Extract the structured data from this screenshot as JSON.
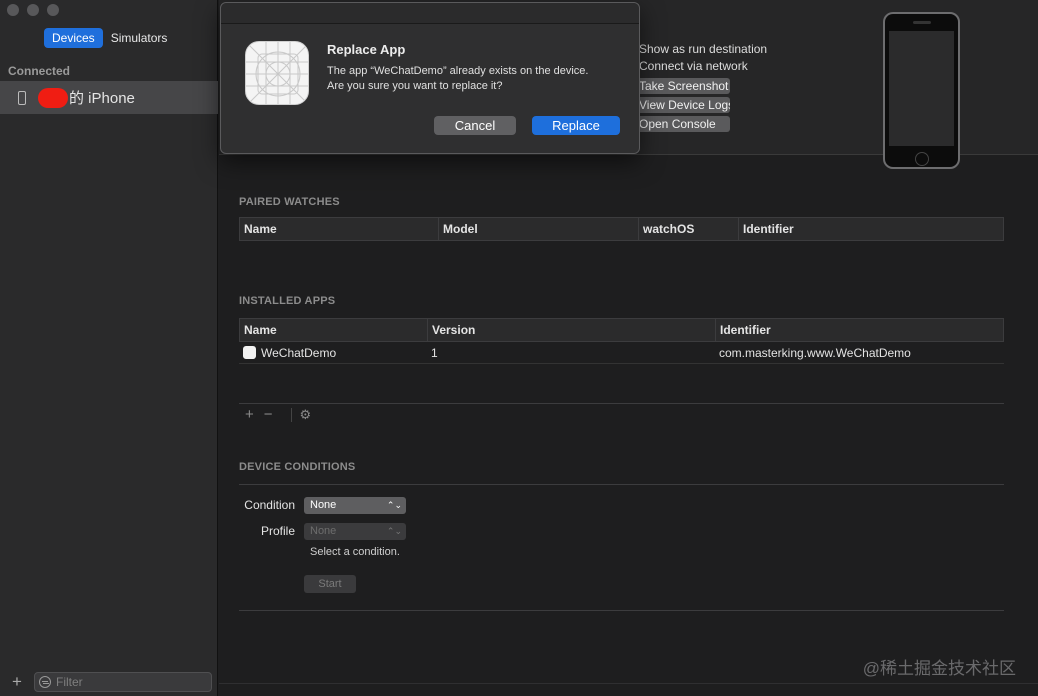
{
  "sidebar": {
    "tabs": {
      "devices": "Devices",
      "simulators": "Simulators"
    },
    "connected_label": "Connected",
    "device_name": "的 iPhone",
    "filter_placeholder": "Filter",
    "add_label": "+"
  },
  "device_panel": {
    "show_as_run_destination": "Show as run destination",
    "connect_via_network": "Connect via network",
    "take_screenshot": "Take Screenshot",
    "view_device_logs": "View Device Logs",
    "open_console": "Open Console"
  },
  "paired_watches": {
    "title": "PAIRED WATCHES",
    "columns": [
      "Name",
      "Model",
      "watchOS",
      "Identifier"
    ]
  },
  "installed_apps": {
    "title": "INSTALLED APPS",
    "columns": [
      "Name",
      "Version",
      "Identifier"
    ],
    "rows": [
      {
        "name": "WeChatDemo",
        "version": "1",
        "identifier": "com.masterking.www.WeChatDemo"
      }
    ],
    "toolbar": {
      "add": "+",
      "remove": "−",
      "gear": "⚙"
    }
  },
  "device_conditions": {
    "title": "DEVICE CONDITIONS",
    "condition_label": "Condition",
    "condition_value": "None",
    "profile_label": "Profile",
    "profile_value": "None",
    "hint": "Select a condition.",
    "start_label": "Start"
  },
  "dialog": {
    "title": "Replace App",
    "message_line1": "The app “WeChatDemo” already exists on the device.",
    "message_line2": "Are you sure you want to replace it?",
    "cancel": "Cancel",
    "replace": "Replace"
  },
  "watermark": "@稀土掘金技术社区",
  "colors": {
    "accent": "#1f6fdc",
    "background": "#1e1e1f",
    "sidebar": "#2a2a2b"
  }
}
